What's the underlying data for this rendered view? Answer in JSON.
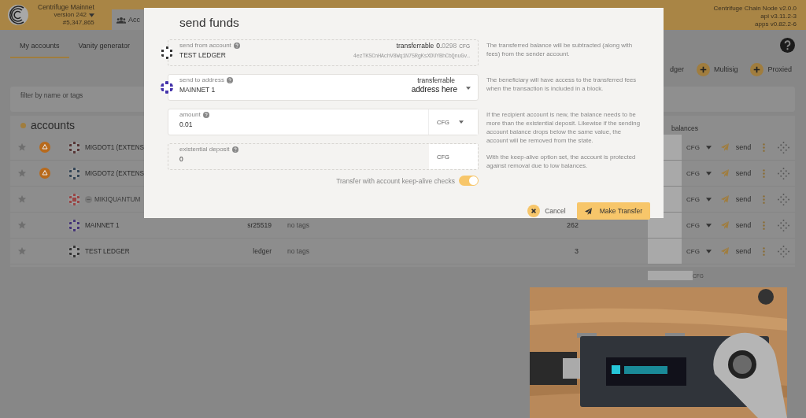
{
  "header": {
    "network": "Centrifuge Mainnet",
    "version": "version 242",
    "block": "#5,347,865",
    "tab": "Acc",
    "node_info": [
      "Centrifuge Chain Node v2.0.0",
      "api v3.11.2-3",
      "apps v0.82.2-6"
    ]
  },
  "subnav": [
    {
      "label": "My accounts",
      "selected": true
    },
    {
      "label": "Vanity generator",
      "selected": false
    }
  ],
  "actions": [
    {
      "label": "dger",
      "kind": "cut"
    },
    {
      "label": "Multisig",
      "kind": "plus"
    },
    {
      "label": "Proxied",
      "kind": "plus"
    }
  ],
  "filter": {
    "placeholder": "filter by name or tags"
  },
  "accounts": {
    "title": "accounts",
    "balances_header": "balances",
    "total_unit": "CFG",
    "rows": [
      {
        "name": "MIGDOT1 (EXTENS",
        "warning": true,
        "disabled": false,
        "color": "#553333",
        "unit": "CFG",
        "send": "send"
      },
      {
        "name": "MIGDOT2 (EXTENS",
        "warning": true,
        "disabled": false,
        "color": "#334455",
        "unit": "CFG",
        "send": "send"
      },
      {
        "name": "MIKIQUANTUM",
        "warning": false,
        "disabled": true,
        "color": "#994444",
        "unit": "CFG",
        "send": "send"
      },
      {
        "name": "MAINNET 1",
        "warning": false,
        "disabled": false,
        "color": "#443377",
        "type": "sr25519",
        "tags": "no tags",
        "balance": "262",
        "unit": "CFG",
        "send": "send"
      },
      {
        "name": "TEST LEDGER",
        "warning": false,
        "disabled": false,
        "color": "#333333",
        "type": "ledger",
        "tags": "no tags",
        "balance": "3",
        "unit": "CFG",
        "send": "send"
      }
    ]
  },
  "modal": {
    "title": "send funds",
    "from": {
      "label": "send from account",
      "value": "TEST LEDGER",
      "transferrable": "transferrable",
      "balance_int": "0.",
      "balance_frac": "0298",
      "unit": "CFG",
      "address": "4ezTKSCnHAchV8Wq1N75RgKsXDUYBhCbQnuGv…",
      "color": "#333333"
    },
    "to": {
      "label": "send to address",
      "value": "MAINNET 1",
      "transferrable": "transferrable",
      "address": "address here",
      "color": "#4433aa"
    },
    "amount": {
      "label": "amount",
      "value": "0.01",
      "unit": "CFG"
    },
    "deposit": {
      "label": "existential deposit",
      "value": "0",
      "unit": "CFG"
    },
    "keep_alive": {
      "label": "Transfer with account keep-alive checks",
      "on": true
    },
    "help": [
      "The transferred balance will be subtracted (along with fees) from the sender account.",
      "The beneficiary will have access to the transferred fees when the transaction is included in a block.",
      "If the recipient account is new, the balance needs to be more than the existential deposit. Likewise if the sending account balance drops below the same value, the account will be removed from the state.",
      "With the keep-alive option set, the account is protected against removal due to low balances."
    ],
    "buttons": [
      {
        "label": "Cancel",
        "kind": "cancel"
      },
      {
        "label": "Make Transfer",
        "kind": "primary"
      }
    ]
  }
}
